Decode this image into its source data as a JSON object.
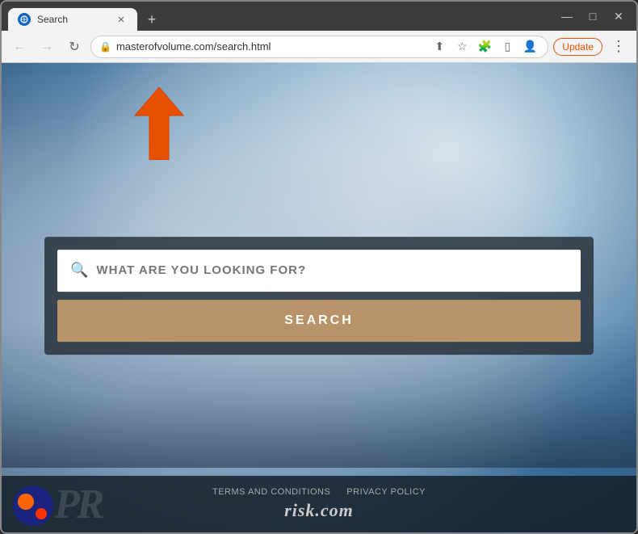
{
  "browser": {
    "tab": {
      "title": "Search",
      "favicon_label": "globe-icon"
    },
    "new_tab_label": "+",
    "window_controls": {
      "minimize": "—",
      "maximize": "□",
      "close": "✕"
    },
    "nav": {
      "back_label": "←",
      "forward_label": "→",
      "refresh_label": "↻",
      "address": "masterofvolume.com/search.html",
      "share_label": "⬆",
      "bookmark_label": "☆",
      "extensions_label": "🧩",
      "sidebar_label": "▯",
      "profile_label": "👤",
      "update_label": "Update",
      "menu_label": "⋮"
    }
  },
  "page": {
    "search": {
      "placeholder": "WHAT ARE YOU LOOKING FOR?",
      "button_label": "SEARCH"
    },
    "footer": {
      "terms_label": "TERMS AND CONDITIONS",
      "privacy_label": "PRIVACY POLICY",
      "brand_prefix": "risk",
      "brand_suffix": ".com"
    }
  }
}
